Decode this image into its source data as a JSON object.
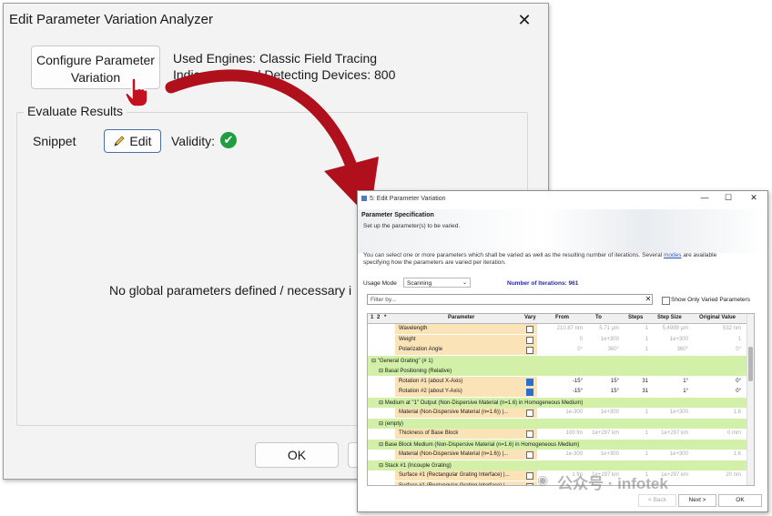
{
  "dialog1": {
    "title": "Edit Parameter Variation Analyzer",
    "close_label": "✕",
    "configure_label_line1": "Configure Parameter",
    "configure_label_line2": "Variation",
    "used_engines": "Used Engines: Classic Field Tracing",
    "indices": "Indices of Used Detecting Devices: 800",
    "evaluate_group": "Evaluate Results",
    "snippet_label": "Snippet",
    "edit_label": "Edit",
    "validity_label": "Validity:",
    "no_global_text": "No global parameters defined / necessary i",
    "ok_label": "OK"
  },
  "dialog2": {
    "title": "5: Edit Parameter Variation",
    "header_title": "Parameter Specification",
    "header_subtitle": "Set up the parameter(s) to be varied.",
    "desc_line1_a": "You can select one or more parameters which shall be varied as well as the resulting number of iterations. Several ",
    "desc_link": "modes",
    "desc_line1_b": " are available",
    "desc_line2": "specifying how the parameters are varied per iteration.",
    "usage_mode_label": "Usage Mode",
    "usage_mode_value": "Scanning",
    "iterations": "Number of Iterations: 961",
    "filter_placeholder": "Filter by...",
    "show_only_label": "Show Only Varied Parameters",
    "columns": [
      "1",
      "2",
      "*",
      "Parameter",
      "Vary",
      "From",
      "To",
      "Steps",
      "Step Size",
      "Original Value"
    ],
    "rows": [
      {
        "kind": "param",
        "name": "Wavelength",
        "vary": false,
        "from": "210.87 nm",
        "to": "5.71 µm",
        "steps": "1",
        "step": "5.4999 µm",
        "orig": "532 nm"
      },
      {
        "kind": "param",
        "name": "Weight",
        "vary": false,
        "from": "0",
        "to": "1e+300",
        "steps": "1",
        "step": "1e+300",
        "orig": "1"
      },
      {
        "kind": "param",
        "name": "Polarization Angle",
        "vary": false,
        "from": "0°",
        "to": "360°",
        "steps": "1",
        "step": "360°",
        "orig": "0°"
      },
      {
        "kind": "group",
        "name": "\"General Grating\" (# 1)",
        "indent": 0
      },
      {
        "kind": "group",
        "name": "Basal Positioning (Relative)",
        "indent": 1
      },
      {
        "kind": "param",
        "name": "Rotation #1 (about X-Axis)",
        "vary": true,
        "from": "-15°",
        "to": "15°",
        "steps": "31",
        "step": "1°",
        "orig": "0°"
      },
      {
        "kind": "param",
        "name": "Rotation #2 (about Y-Axis)",
        "vary": true,
        "from": "-15°",
        "to": "15°",
        "steps": "31",
        "step": "1°",
        "orig": "0°"
      },
      {
        "kind": "group",
        "name": "Medium at \"1\" Output (Non-Dispersive Material (n=1.6) in Homogeneous Medium)",
        "indent": 1
      },
      {
        "kind": "param",
        "name": "Material (Non-Dispersive Material (n=1.6)) |...",
        "vary": false,
        "from": "1e-300",
        "to": "1e+300",
        "steps": "1",
        "step": "1e+300",
        "orig": "1.6"
      },
      {
        "kind": "group",
        "name": "(empty)",
        "indent": 1
      },
      {
        "kind": "param",
        "name": "Thickness of Base Block",
        "vary": false,
        "from": "100 fm",
        "to": "1e+297 km",
        "steps": "1",
        "step": "1e+297 km",
        "orig": "0 mm"
      },
      {
        "kind": "group",
        "name": "Base Block Medium (Non-Dispersive Material (n=1.6) in Homogeneous Medium)",
        "indent": 1
      },
      {
        "kind": "param",
        "name": "Material (Non-Dispersive Material (n=1.6)) |...",
        "vary": false,
        "from": "1e-300",
        "to": "1e+300",
        "steps": "1",
        "step": "1e+300",
        "orig": "1.6"
      },
      {
        "kind": "group",
        "name": "Stack #1 (Incouple Grating)",
        "indent": 1
      },
      {
        "kind": "param",
        "name": "Surface #1 (Rectangular Grating Interface) |...",
        "vary": false,
        "from": "1 fm",
        "to": "1e+297 km",
        "steps": "1",
        "step": "1e+297 km",
        "orig": "20 nm"
      },
      {
        "kind": "param",
        "name": "Surface #1 (Rectangular Grating Interface) |...",
        "vary": false,
        "from": "",
        "to": "",
        "steps": "",
        "step": "",
        "orig": ""
      }
    ],
    "back_label": "< Back",
    "next_label": "Next >",
    "ok_label": "OK"
  },
  "watermark": "公众号 · infotek",
  "colors": {
    "arrow": "#b0101c",
    "group_row": "#d2f0a8",
    "param_cell": "#fbe3b8",
    "valid": "#1e9e3e"
  }
}
